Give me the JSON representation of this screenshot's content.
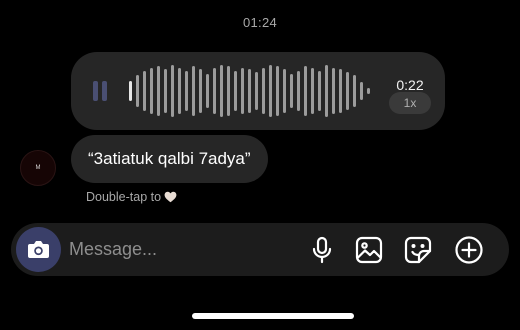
{
  "status": {
    "time": "01:24"
  },
  "voice_message": {
    "duration": "0:22",
    "playback_speed": "1x",
    "pause_icon": "pause-icon",
    "waveform_levels": [
      0.35,
      0.55,
      0.7,
      0.8,
      0.85,
      0.75,
      0.9,
      0.8,
      0.7,
      0.85,
      0.75,
      0.6,
      0.8,
      0.9,
      0.85,
      0.7,
      0.8,
      0.75,
      0.65,
      0.8,
      0.9,
      0.85,
      0.75,
      0.6,
      0.7,
      0.85,
      0.8,
      0.7,
      0.9,
      0.8,
      0.75,
      0.65,
      0.55,
      0.3,
      0.1
    ],
    "progress": 0.02
  },
  "message": {
    "text": "“3atiatuk qalbi 7adya”",
    "avatar_initial": "M",
    "reaction_hint": "Double-tap to",
    "reaction_icon": "heart-icon"
  },
  "composer": {
    "placeholder": "Message...",
    "camera_icon": "camera-icon",
    "tools": [
      "microphone-icon",
      "image-icon",
      "sticker-icon",
      "plus-icon"
    ]
  },
  "colors": {
    "background": "#000000",
    "bubble": "#262626",
    "composer": "#1c1c1c",
    "accent": "#3a3f69",
    "muted_text": "#a8a8a8"
  }
}
